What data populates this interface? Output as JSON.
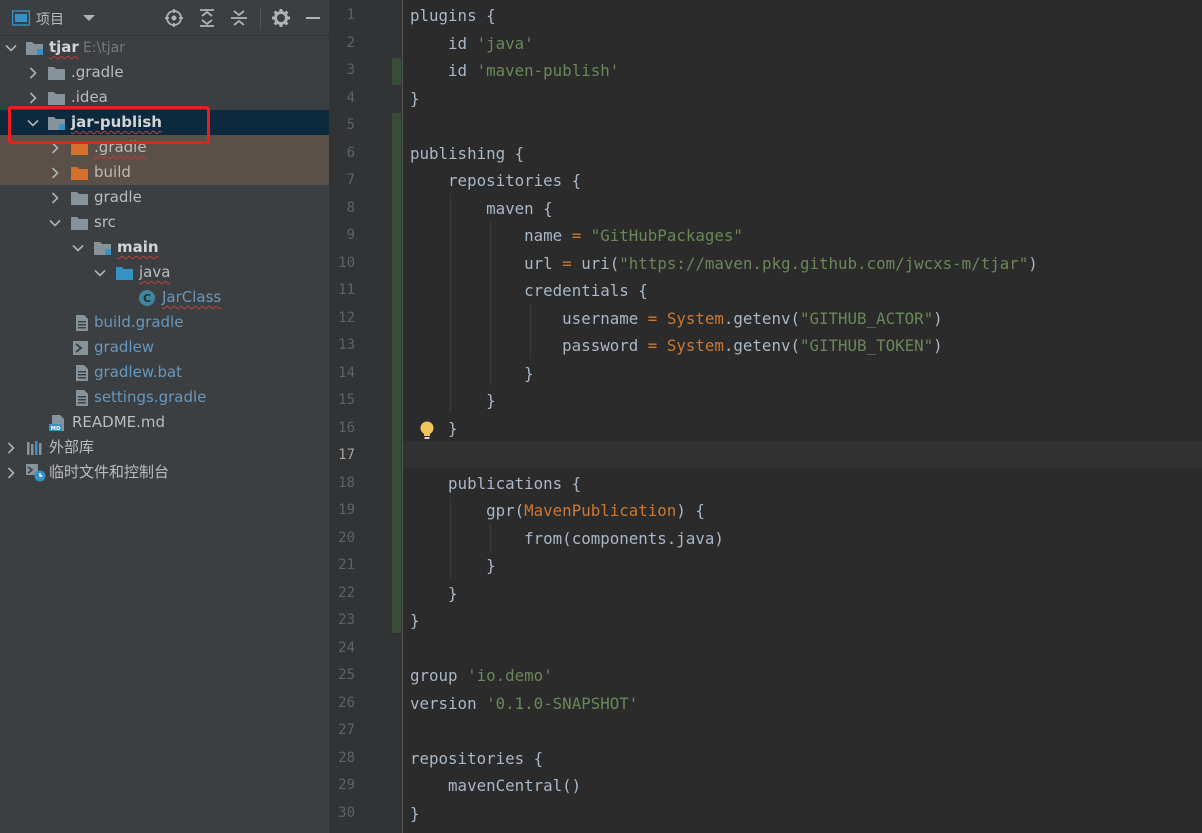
{
  "project_panel": {
    "title": "项目",
    "tree": [
      {
        "label": "tjar",
        "hint": "E:\\tjar",
        "expanded": true,
        "icon": "module-folder-icon"
      },
      {
        "label": ".gradle",
        "expanded": false,
        "icon": "folder-icon"
      },
      {
        "label": ".idea",
        "expanded": false,
        "icon": "folder-icon"
      },
      {
        "label": "jar-publish",
        "expanded": true,
        "icon": "module-folder-icon",
        "selected": true
      },
      {
        "label": ".gradle",
        "expanded": false,
        "icon": "excluded-folder-icon"
      },
      {
        "label": "build",
        "expanded": false,
        "icon": "excluded-folder-icon"
      },
      {
        "label": "gradle",
        "expanded": false,
        "icon": "folder-icon"
      },
      {
        "label": "src",
        "expanded": true,
        "icon": "folder-icon"
      },
      {
        "label": "main",
        "expanded": true,
        "icon": "module-folder-icon"
      },
      {
        "label": "java",
        "expanded": true,
        "icon": "source-folder-icon"
      },
      {
        "label": "JarClass",
        "icon": "java-class-icon"
      },
      {
        "label": "build.gradle",
        "icon": "gradle-file-icon"
      },
      {
        "label": "gradlew",
        "icon": "shell-script-icon"
      },
      {
        "label": "gradlew.bat",
        "icon": "text-file-icon"
      },
      {
        "label": "settings.gradle",
        "icon": "gradle-file-icon"
      },
      {
        "label": "README.md",
        "icon": "markdown-file-icon"
      },
      {
        "label": "外部库",
        "expanded": false,
        "icon": "library-icon"
      },
      {
        "label": "临时文件和控制台",
        "expanded": false,
        "icon": "scratch-icon"
      }
    ]
  },
  "editor": {
    "current_line": "17",
    "line_numbers": [
      "1",
      "2",
      "3",
      "4",
      "5",
      "6",
      "7",
      "8",
      "9",
      "10",
      "11",
      "12",
      "13",
      "14",
      "15",
      "16",
      "17",
      "18",
      "19",
      "20",
      "21",
      "22",
      "23",
      "24",
      "25",
      "26",
      "27",
      "28",
      "29",
      "30"
    ],
    "code": {
      "l1": "plugins {",
      "l2_kw": "id",
      "l2_str": "'java'",
      "l3_kw": "id",
      "l3_str": "'maven-publish'",
      "l4": "}",
      "l6": "publishing {",
      "l7": "repositories {",
      "l8": "maven {",
      "l9_a": "name",
      "l9_b": " = ",
      "l9_str": "\"GitHubPackages\"",
      "l10_a": "url",
      "l10_b": " = ",
      "l10_c": "uri(",
      "l10_str": "\"https://maven.pkg.github.com/jwcxs-m/tjar\"",
      "l10_d": ")",
      "l11": "credentials {",
      "l12_a": "username",
      "l12_b": " = ",
      "l12_cls": "System",
      "l12_c": ".getenv(",
      "l12_str": "\"GITHUB_ACTOR\"",
      "l12_d": ")",
      "l13_a": "password",
      "l13_b": " = ",
      "l13_cls": "System",
      "l13_c": ".getenv(",
      "l13_str": "\"GITHUB_TOKEN\"",
      "l13_d": ")",
      "l14": "}",
      "l15": "}",
      "l16": "}",
      "l18": "publications {",
      "l19_a": "gpr(",
      "l19_cls": "MavenPublication",
      "l19_b": ") {",
      "l20": "from(components.java)",
      "l21": "}",
      "l22": "}",
      "l23": "}",
      "l25_a": "group",
      "l25_str": "'io.demo'",
      "l26_a": "version",
      "l26_str": "'0.1.0-SNAPSHOT'",
      "l28": "repositories {",
      "l29": "mavenCentral()",
      "l30": "}"
    }
  },
  "colors": {
    "string": "#6a8759",
    "keyword": "#cc7832",
    "default": "#a9b7c6",
    "highlight_box": "#ee1c1c"
  }
}
